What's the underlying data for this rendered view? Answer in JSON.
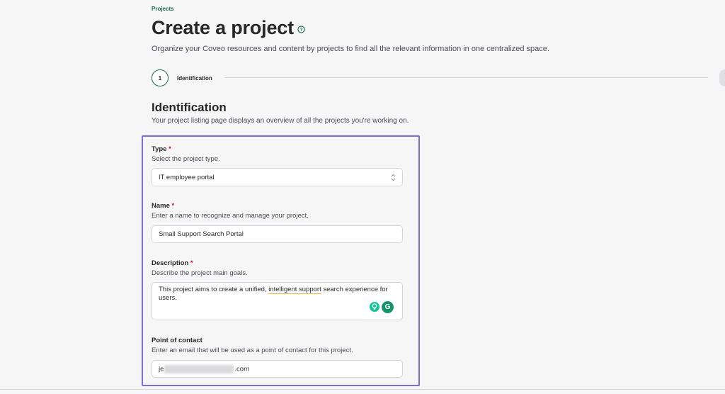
{
  "breadcrumb": "Projects",
  "page": {
    "title": "Create a project",
    "subtitle": "Organize your Coveo resources and content by projects to find all the relevant information in one centralized space."
  },
  "stepper": {
    "step_number": "1",
    "step_label": "Identification"
  },
  "section": {
    "title": "Identification",
    "description": "Your project listing page displays an overview of all the projects you're working on."
  },
  "form": {
    "type": {
      "label": "Type",
      "required_mark": "*",
      "help": "Select the project type.",
      "value": "IT employee portal"
    },
    "name": {
      "label": "Name",
      "required_mark": "*",
      "help": "Enter a name to recognize and manage your project.",
      "value": "Small Support Search Portal"
    },
    "description": {
      "label": "Description",
      "required_mark": "*",
      "help": "Describe the project main goals.",
      "value_part1": "This project aims to create a unified, ",
      "value_underlined": "intelligent support",
      "value_part2": " search experience for users."
    },
    "contact": {
      "label": "Point of contact",
      "help": "Enter an email that will be used as a point of contact for this project.",
      "value_prefix": "je",
      "value_suffix": ".com"
    }
  },
  "colors": {
    "accent_green": "#1a6b52",
    "focus_outline": "#7b6ce0",
    "required_red": "#c8102e",
    "grammarly_green": "#15946b"
  },
  "icons": [
    "help-circle-icon",
    "chevron-updown-icon",
    "lightbulb-icon",
    "grammarly-icon"
  ]
}
